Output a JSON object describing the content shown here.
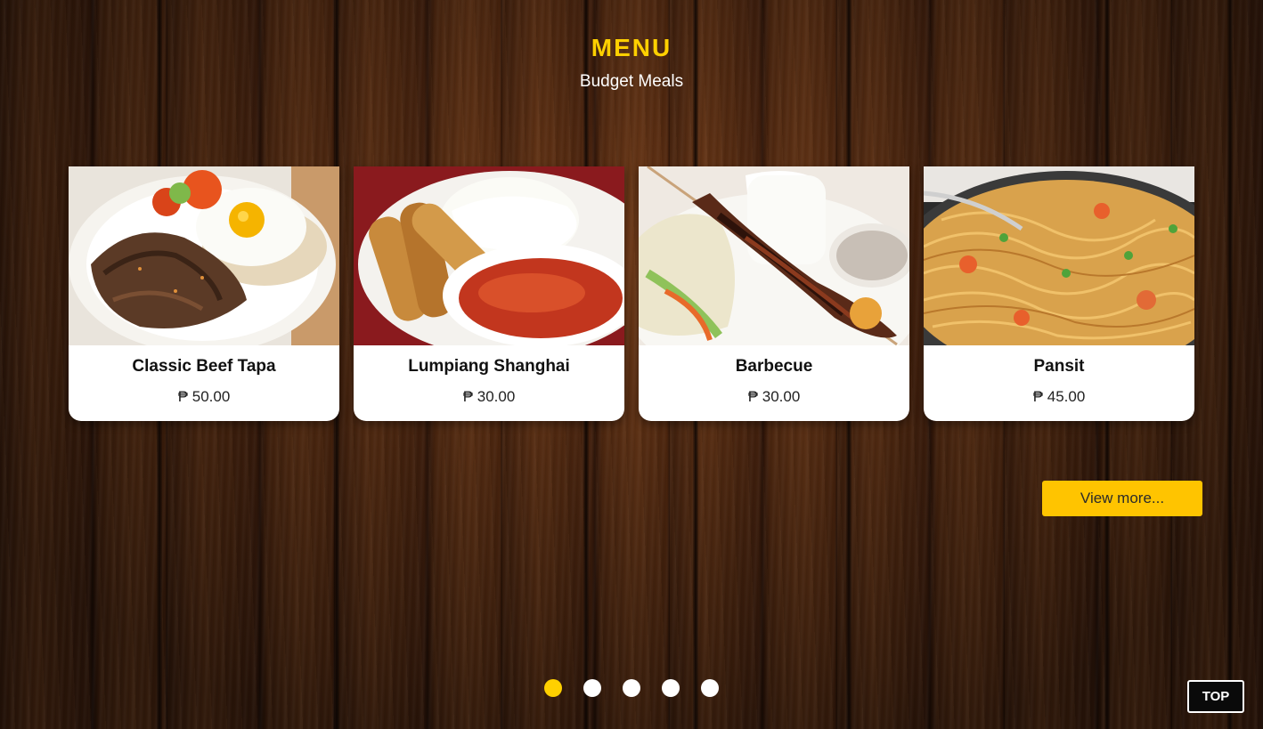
{
  "header": {
    "title": "MENU",
    "subtitle": "Budget Meals"
  },
  "menu_items": [
    {
      "name": "Classic Beef Tapa",
      "price": "₱ 50.00",
      "image": "beef-tapa-photo"
    },
    {
      "name": "Lumpiang Shanghai",
      "price": "₱ 30.00",
      "image": "lumpiang-shanghai-photo"
    },
    {
      "name": "Barbecue",
      "price": "₱ 30.00",
      "image": "barbecue-photo"
    },
    {
      "name": "Pansit",
      "price": "₱ 45.00",
      "image": "pansit-photo"
    }
  ],
  "actions": {
    "view_more_label": "View more...",
    "top_label": "TOP"
  },
  "carousel": {
    "page_count": 5,
    "active_index": 0
  },
  "colors": {
    "accent": "#ffd000",
    "button": "#ffc400",
    "card_bg": "#ffffff",
    "wood": "#4a2410"
  }
}
